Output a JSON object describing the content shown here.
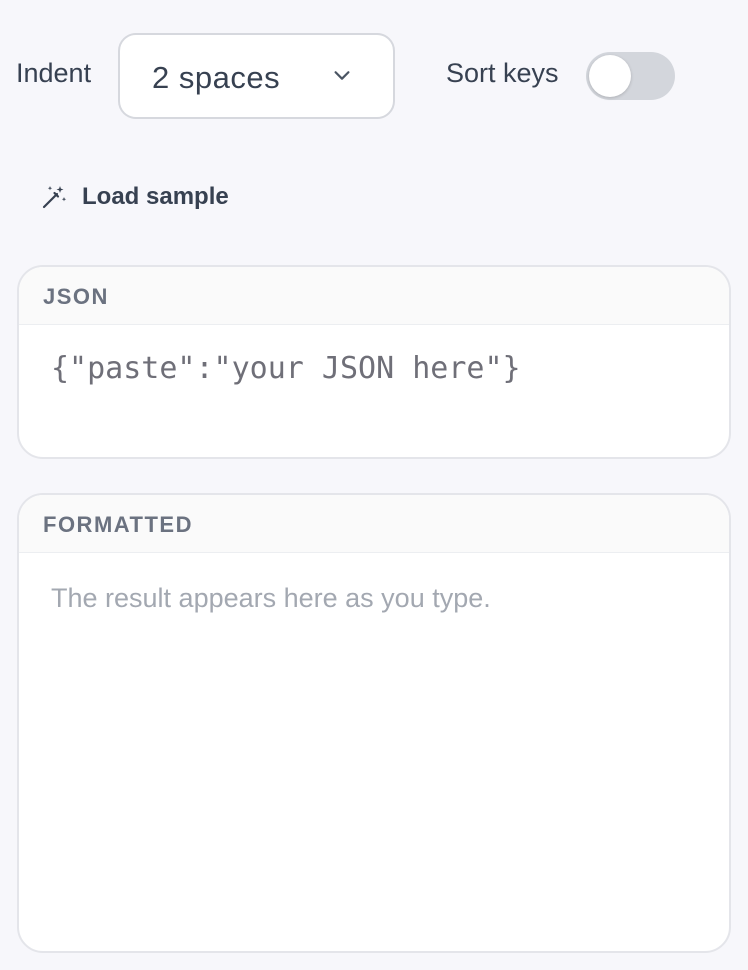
{
  "controls": {
    "indent_label": "Indent",
    "indent_value": "2 spaces",
    "sort_keys_label": "Sort keys",
    "sort_keys_on": false
  },
  "load_sample": {
    "label": "Load sample",
    "icon": "magic-wand-icon"
  },
  "json_panel": {
    "title": "JSON",
    "placeholder": "{\"paste\":\"your JSON here\"}",
    "value": ""
  },
  "formatted_panel": {
    "title": "FORMATTED",
    "empty_text": "The result appears here as you type."
  },
  "colors": {
    "background": "#f7f7fb",
    "text": "#374151",
    "muted": "#a3a8b1",
    "border": "#e4e5ea",
    "toggle_off": "#d3d6dc"
  }
}
